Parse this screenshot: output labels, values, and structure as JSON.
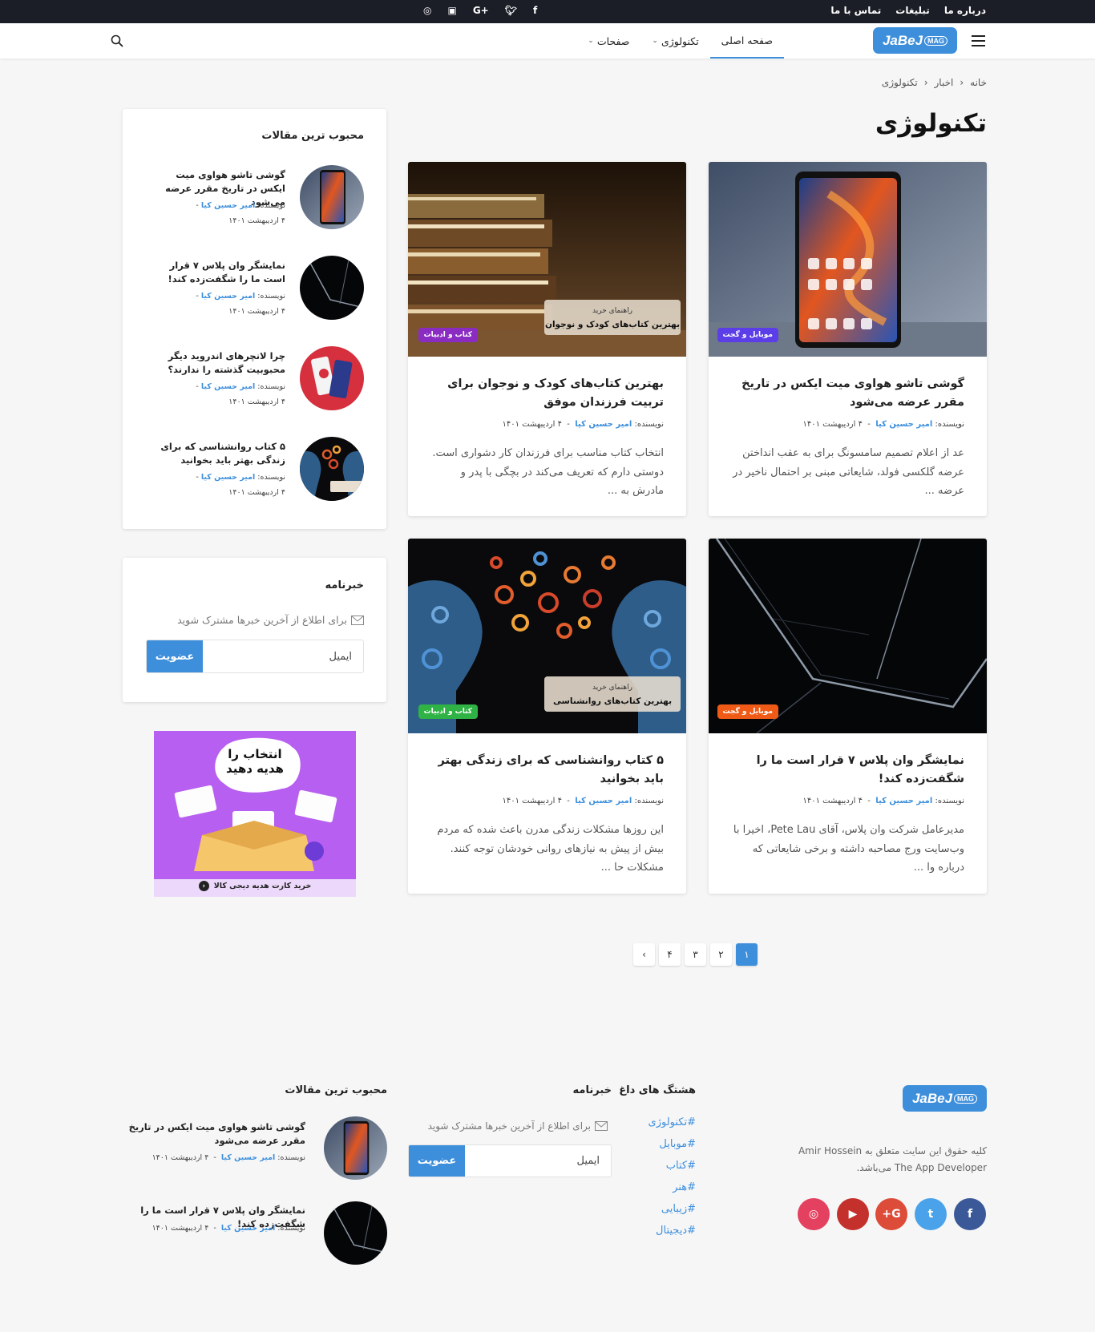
{
  "topbar": {
    "links": [
      "درباره ما",
      "تبلیغات",
      "تماس با ما"
    ],
    "social": [
      "f",
      "t",
      "G+",
      "yt",
      "ig"
    ]
  },
  "nav": {
    "logo": {
      "text": "JaBeJ",
      "badge": "MAG"
    },
    "items": [
      {
        "label": "صفحه اصلی",
        "active": true,
        "dropdown": false
      },
      {
        "label": "تکنولوژی",
        "active": false,
        "dropdown": true
      },
      {
        "label": "صفحات",
        "active": false,
        "dropdown": true
      }
    ]
  },
  "breadcrumb": [
    "خانه",
    "اخبار",
    "تکنولوژی"
  ],
  "page_title": "تکنولوژی",
  "posts": [
    {
      "badge": "موبایل و گجت",
      "badge_color": "#5b3ee8",
      "title": "گوشی تاشو هواوی میت ایکس در تاریخ مقرر عرضه می‌شود",
      "author_prefix": "نویسنده:",
      "author": "امیر حسین کیا",
      "date": "۴ اردیبهشت ۱۴۰۱",
      "excerpt": "عد از اعلام تصمیم سامسونگ برای به عقب انداختن عرضه گلکسی فولد، شایعاتی مبنی بر احتمال ناخیر در عرضه ..."
    },
    {
      "badge": "کتاب و ادبیات",
      "badge_color": "#8a2cc2",
      "title": "بهترین کتاب‌های کودک و نوجوان برای تربیت فرزندان موفق",
      "author_prefix": "نویسنده:",
      "author": "امیر حسین کیا",
      "date": "۴ اردیبهشت ۱۴۰۱",
      "excerpt": "انتخاب کتاب مناسب برای فرزندان کار دشواری است. دوستی دارم که تعریف می‌کند در بچگی با پدر و مادرش به ..."
    },
    {
      "badge": "موبایل و گجت",
      "badge_color": "#ef5b16",
      "title": "نمایشگر وان پلاس ۷ قرار است ما را شگفت‌زده کند!",
      "author_prefix": "نویسنده:",
      "author": "امیر حسین کیا",
      "date": "۴ اردیبهشت ۱۴۰۱",
      "excerpt": "مدیرعامل شرکت وان پلاس، آقای Pete Lau، اخیرا با وب‌سایت ورج مصاحبه داشته و برخی شایعاتی که درباره وا ..."
    },
    {
      "badge": "کتاب و ادبیات",
      "badge_color": "#2fb344",
      "title": "۵ کتاب روانشناسی که برای زندگی بهتر باید بخوانید",
      "author_prefix": "نویسنده:",
      "author": "امیر حسین کیا",
      "date": "۴ اردیبهشت ۱۴۰۱",
      "excerpt": "این روزها مشکلات زندگی مدرن باعث شده که مردم بیش از پیش به نیازهای روانی خودشان توجه کنند. مشکلات حا ..."
    }
  ],
  "book_banners": {
    "kids": {
      "line1": "راهنمای خرید",
      "line2": "بهترین کتاب‌های کودک و نوجوان"
    },
    "psych": {
      "line1": "راهنمای خرید",
      "line2": "بهترین کتاب‌های روانشناسی"
    }
  },
  "sidebar": {
    "popular_title": "محبوب ترین مقالات",
    "popular": [
      {
        "title": "گوشی تاشو هواوی میت ایکس در تاریخ مقرر عرضه می‌شود",
        "author_prefix": "نویسنده:",
        "author": "امیر حسین کیا",
        "date": "۴ اردیبهشت ۱۴۰۱"
      },
      {
        "title": "نمایشگر وان پلاس ۷ قرار است ما را شگفت‌زده کند!",
        "author_prefix": "نویسنده:",
        "author": "امیر حسین کیا",
        "date": "۴ اردیبهشت ۱۴۰۱"
      },
      {
        "title": "چرا لانچرهای اندروید دیگر محبوبیت گذشته را ندارند؟",
        "author_prefix": "نویسنده:",
        "author": "امیر حسین کیا",
        "date": "۴ اردیبهشت ۱۴۰۱"
      },
      {
        "title": "۵ کتاب روانشناسی که برای زندگی بهتر باید بخوانید",
        "author_prefix": "نویسنده:",
        "author": "امیر حسین کیا",
        "date": "۴ اردیبهشت ۱۴۰۱"
      }
    ],
    "newsletter_title": "خبرنامه",
    "newsletter_desc": "برای اطلاع از آخرین خبرها مشترک شوید",
    "newsletter_placeholder": "ایمیل",
    "newsletter_button": "عضویت",
    "ad": {
      "headline1": "انتخاب را",
      "headline2": "هدیه دهید",
      "cta": "خرید کارت هدیه دیجی کالا"
    }
  },
  "pagination": {
    "pages": [
      "۱",
      "۲",
      "۳",
      "۴"
    ],
    "active": "۱",
    "next": "‹"
  },
  "footer": {
    "logo": {
      "text": "JaBeJ",
      "badge": "MAG"
    },
    "copyright": "کلیه حقوق این سایت متعلق به Amir Hossein The App Developer می‌باشد.",
    "social": [
      {
        "name": "facebook",
        "glyph": "f",
        "color": "#3b5998"
      },
      {
        "name": "twitter",
        "glyph": "t",
        "color": "#4aa3ea"
      },
      {
        "name": "google-plus",
        "glyph": "G+",
        "color": "#dd4b39"
      },
      {
        "name": "youtube",
        "glyph": "▶",
        "color": "#c4302b"
      },
      {
        "name": "instagram",
        "glyph": "◎",
        "color": "#e4405f"
      }
    ],
    "tags_title": "هشتگ های داغ",
    "tags": [
      "#تکنولوژی",
      "#موبایل",
      "#کتاب",
      "#هنر",
      "#زیبایی",
      "#دیجیتال"
    ],
    "newsletter_title": "خبرنامه",
    "newsletter_desc": "برای اطلاع از آخرین خبرها مشترک شوید",
    "newsletter_placeholder": "ایمیل",
    "newsletter_button": "عضویت",
    "popular_title": "محبوب ترین مقالات",
    "popular": [
      {
        "title": "گوشی تاشو هواوی میت ایکس در تاریخ مقرر عرضه می‌شود",
        "author_prefix": "نویسنده:",
        "author": "امیر حسین کیا",
        "date": "۴ اردیبهشت ۱۴۰۱"
      },
      {
        "title": "نمایشگر وان پلاس ۷ قرار است ما را شگفت‌زده کند!",
        "author_prefix": "نویسنده:",
        "author": "امیر حسین کیا",
        "date": "۴ اردیبهشت ۱۴۰۱"
      }
    ]
  }
}
